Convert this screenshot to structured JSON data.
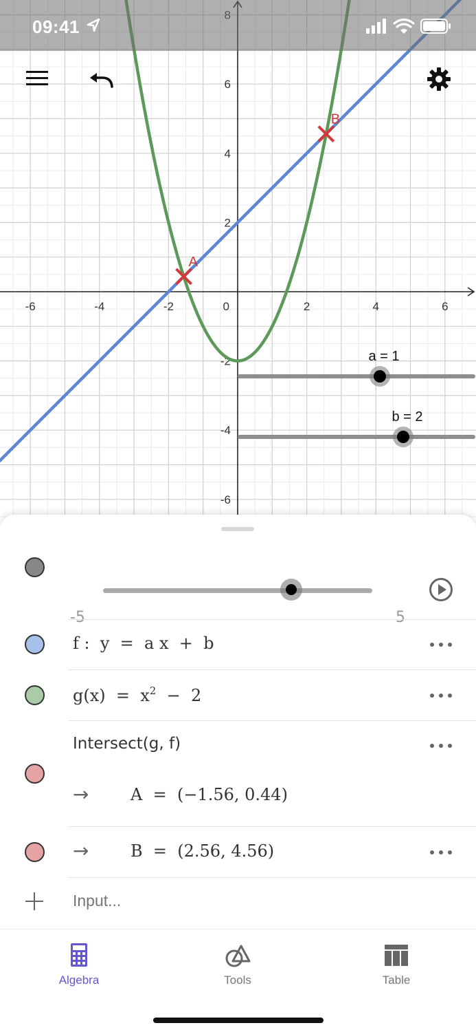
{
  "status_bar": {
    "time": "09:41"
  },
  "graph": {
    "x_tick_labels": [
      "-6",
      "-4",
      "-2",
      "2",
      "4",
      "6"
    ],
    "y_tick_labels": [
      "-6",
      "-4",
      "-2",
      "2",
      "4",
      "6",
      "8"
    ],
    "origin_label": "0",
    "view": {
      "xmin": -6.9,
      "xmax": 6.9,
      "ymin": -6.5,
      "ymax": 8.5
    },
    "colors": {
      "line_f": "#5b87d6",
      "curve_g": "#5d9a5a",
      "points": "#d23a3a",
      "grid_major": "#cfcfcf",
      "grid_minor": "#ececec"
    },
    "points": [
      {
        "name": "A",
        "x": -1.56,
        "y": 0.44
      },
      {
        "name": "B",
        "x": 2.56,
        "y": 4.56
      }
    ],
    "sliders": [
      {
        "label": "a = 1",
        "value": 1,
        "min": -5,
        "max": 5,
        "fraction": 0.6
      },
      {
        "label": "b = 2",
        "value": 2,
        "min": -5,
        "max": 5,
        "fraction": 0.7
      }
    ]
  },
  "algebra": {
    "slider_row": {
      "min_label": "-5",
      "max_label": "5",
      "value": 2,
      "min": -5,
      "max": 5,
      "color": "#888888"
    },
    "f_row": {
      "text": "f :  y  =  a x  +  b",
      "color": "#a7c1ea"
    },
    "g_row": {
      "lhs": "g(x)  =  x",
      "exp": "2",
      "rhs": "  −  2",
      "color": "#a9cca6"
    },
    "intersect_row": {
      "command": "Intersect(g, f)",
      "result_a": "A  =  (−1.56, 0.44)",
      "color": "#e6a3a3"
    },
    "b_row": {
      "result_b": "B  =  (2.56, 4.56)",
      "color": "#e6a3a3"
    },
    "arrow": "→",
    "input_placeholder": "Input..."
  },
  "nav": {
    "items": [
      {
        "label": "Algebra",
        "icon": "calculator-icon",
        "active": true
      },
      {
        "label": "Tools",
        "icon": "shapes-icon",
        "active": false
      },
      {
        "label": "Table",
        "icon": "table-icon",
        "active": false
      }
    ],
    "active_color": "#6557d2"
  }
}
